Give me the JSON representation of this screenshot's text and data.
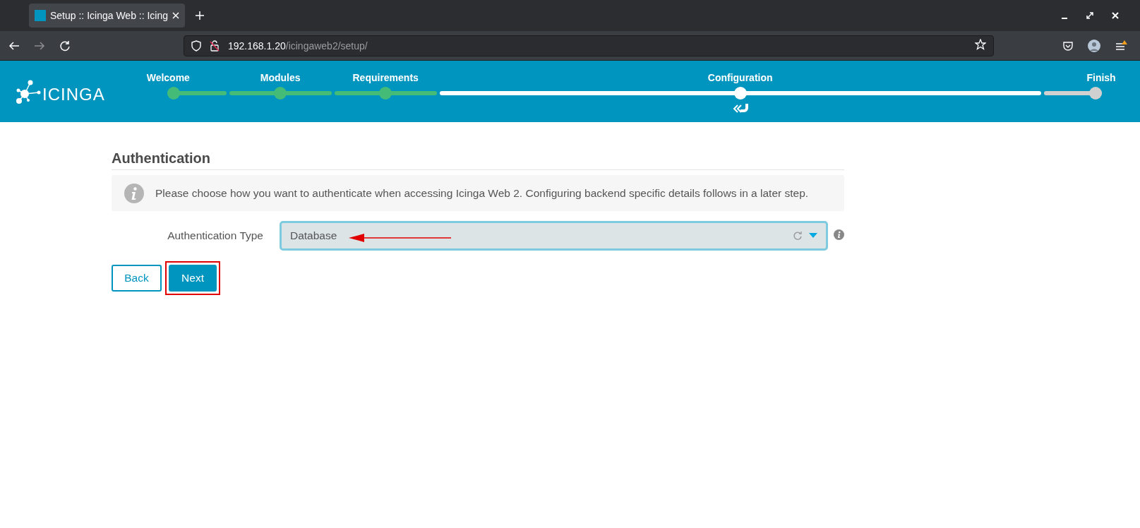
{
  "browser": {
    "tab": {
      "title": "Setup :: Icinga Web :: Icing",
      "selected": true
    },
    "url_host": "192.168.1.20",
    "url_path": "/icingaweb2/setup/"
  },
  "wizard": {
    "logo_text": "ICINGA",
    "steps": [
      {
        "label": "Welcome",
        "done": true,
        "current": false
      },
      {
        "label": "Modules",
        "done": true,
        "current": false
      },
      {
        "label": "Requirements",
        "done": true,
        "current": false
      },
      {
        "label": "Configuration",
        "done": false,
        "current": true
      },
      {
        "label": "Finish",
        "done": false,
        "current": false
      }
    ]
  },
  "page": {
    "heading": "Authentication",
    "info": "Please choose how you want to authenticate when accessing Icinga Web 2. Configuring backend specific details follows in a later step.",
    "field": {
      "label": "Authentication Type",
      "value": "Database"
    },
    "buttons": [
      {
        "label": "Back",
        "kind": "secondary",
        "highlighted": false
      },
      {
        "label": "Next",
        "kind": "primary",
        "highlighted": true
      }
    ]
  }
}
